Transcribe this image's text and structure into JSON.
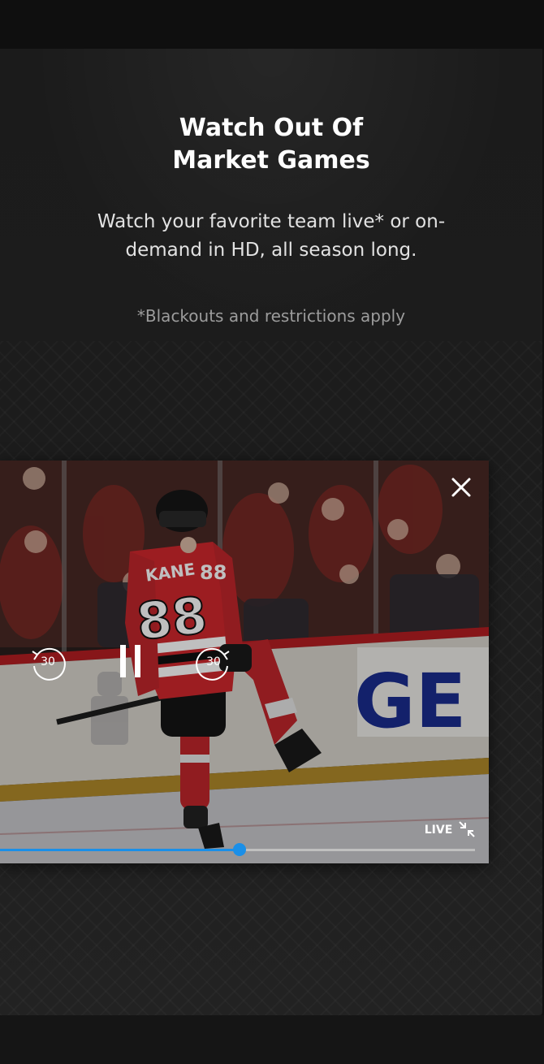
{
  "promo": {
    "title_line1": "Watch Out Of",
    "title_line2": "Market Games",
    "subtitle_line1": "Watch your favorite team live* or on-",
    "subtitle_line2": "demand in HD, all season long.",
    "disclaimer": "*Blackouts and restrictions apply"
  },
  "player": {
    "rewind_label": "30",
    "forward_label": "30",
    "live_label": "LIVE",
    "progress": 0.505,
    "accent_color": "#1a8fe8",
    "jersey_name": "KANE",
    "jersey_number": "88",
    "board_text": "GE",
    "icons": {
      "close": "close-icon",
      "rewind": "rewind-30-icon",
      "pause": "pause-icon",
      "forward": "forward-30-icon",
      "minimize": "minimize-icon"
    }
  }
}
